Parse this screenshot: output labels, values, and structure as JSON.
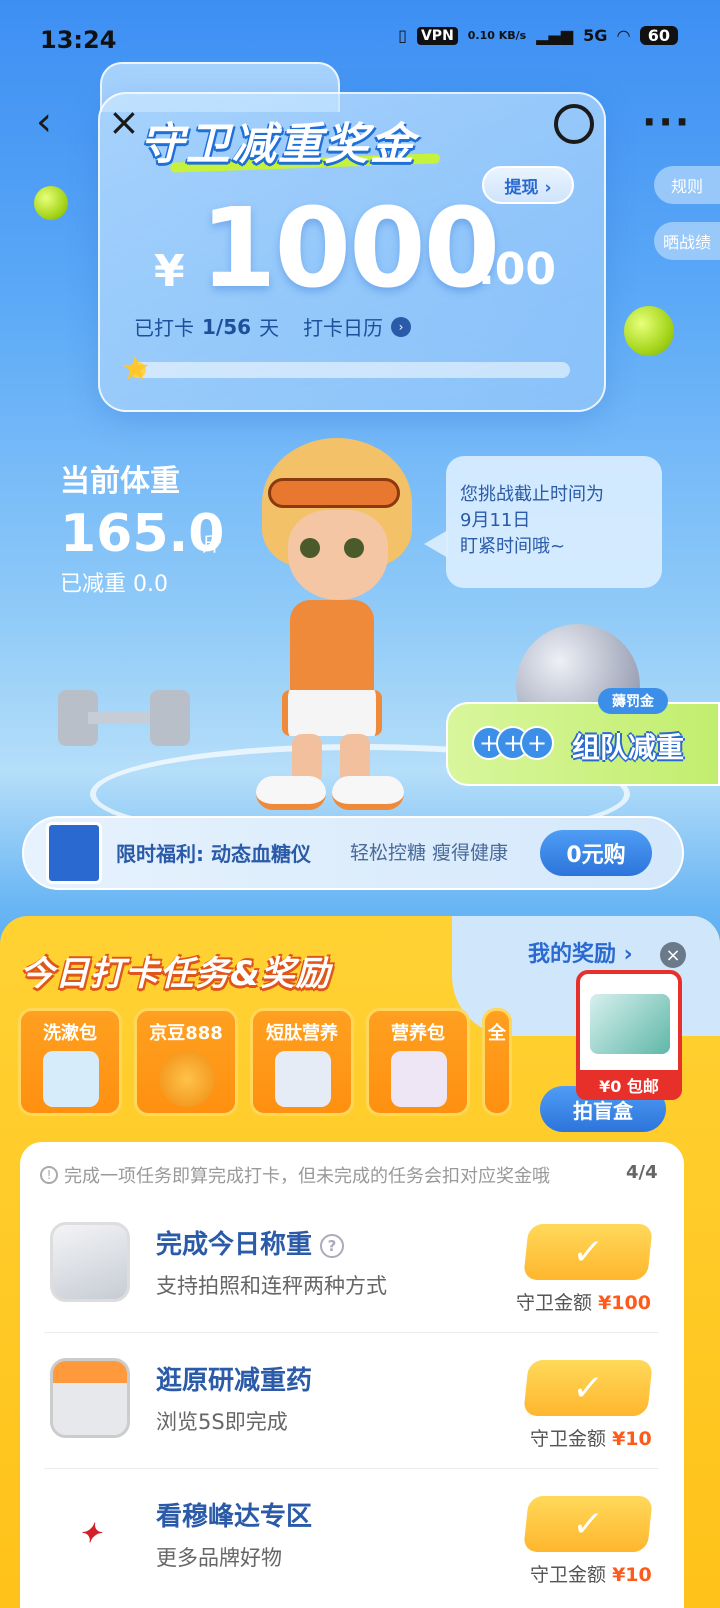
{
  "status_bar": {
    "time": "13:24",
    "vpn": "VPN",
    "net_speed": "0.10 KB/s",
    "signal": "5G",
    "battery": "60"
  },
  "nav": {
    "back_icon": "chevron-left-icon",
    "close_icon": "close-icon",
    "share_icon": "share-icon",
    "more_icon": "more-icon"
  },
  "bonus_card": {
    "title": "守卫减重奖金",
    "withdraw_label": "提现 ›",
    "currency_symbol": "¥",
    "amount_int": "1000",
    "amount_dec": ".00",
    "checkin_prefix": "已打卡",
    "checkin_count": "1/56",
    "checkin_suffix": "天",
    "calendar_label": "打卡日历",
    "progress_fraction": 0.018
  },
  "side_links": {
    "rules": "规则",
    "share_results": "晒战绩"
  },
  "weight": {
    "label": "当前体重",
    "value": "165.0",
    "unit": "斤",
    "lost": "已减重 0.0"
  },
  "bubble": {
    "line1": "您挑战截止时间为",
    "line2": "9月11日",
    "line3": "盯紧时间哦~"
  },
  "team": {
    "badge": "薅罚金",
    "label": "组队减重"
  },
  "promo": {
    "title": "限时福利: 动态血糖仪",
    "subtitle": "轻松控糖 瘦得健康",
    "button": "0元购"
  },
  "tasks_section": {
    "title": "今日打卡任务&奖励",
    "my_rewards": "我的奖励 ›",
    "rewards": [
      {
        "label": "洗漱包"
      },
      {
        "label": "京豆888"
      },
      {
        "label": "短肽营养"
      },
      {
        "label": "营养包"
      },
      {
        "label": "全"
      }
    ],
    "blindbox_button": "拍盲盒",
    "float_ad_tag": "¥0 包邮"
  },
  "task_list": {
    "notice": "完成一项任务即算完成打卡，但未完成的任务会扣对应奖金哦",
    "notice_count": "4/4",
    "guard_label": "守卫金额",
    "items": [
      {
        "name": "完成今日称重",
        "desc": "支持拍照和连秤两种方式",
        "amount": "¥100",
        "done": "✓"
      },
      {
        "name": "逛原研减重药",
        "desc": "浏览5S即完成",
        "amount": "¥10",
        "done": "✓"
      },
      {
        "name": "看穆峰达专区",
        "desc": "更多品牌好物",
        "amount": "¥10",
        "done": "✓"
      }
    ]
  }
}
